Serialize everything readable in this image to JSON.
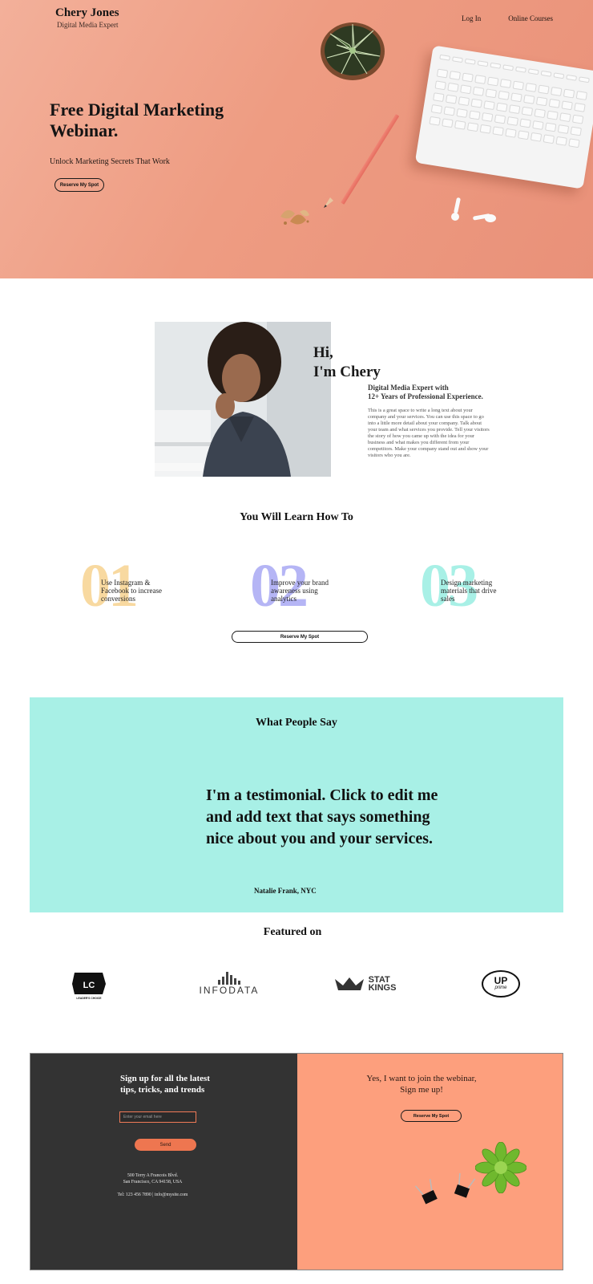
{
  "header": {
    "brand_name": "Chery Jones",
    "brand_tagline": "Digital Media Expert",
    "nav": [
      "Log In",
      "Online Courses"
    ]
  },
  "hero": {
    "title": "Free Digital Marketing Webinar.",
    "subtitle": "Unlock Marketing Secrets That Work",
    "cta": "Reserve My Spot"
  },
  "about": {
    "greeting_line1": "Hi,",
    "greeting_line2": "I'm Chery",
    "headline_line1": "Digital Media Expert with",
    "headline_line2": "12+ Years of Professional Experience.",
    "body": "This is a great space to write a long text about your company and your services. You can use this space to go into a little more detail about your company. Talk about your team and what services you provide. Tell your visitors the story of how you came up with the idea for your business and what makes you different from your competitors. Make your company stand out and show your visitors who you are."
  },
  "learn": {
    "title": "You Will Learn How To",
    "steps": [
      {
        "number": "01",
        "text": "Use Instagram & Facebook to increase conversions",
        "color": "#f8d9a0"
      },
      {
        "number": "02",
        "text": "Improve your brand awareness using analytics",
        "color": "#b5b5f5"
      },
      {
        "number": "03",
        "text": "Design marketing materials that drive sales",
        "color": "#a8f0e6"
      }
    ],
    "cta": "Reserve My Spot"
  },
  "testimonial": {
    "title": "What People Say",
    "quote": "I'm a testimonial. Click to edit me and add text that says something nice about you and your services.",
    "author": "Natalie Frank, NYC",
    "background": "#a8f0e6"
  },
  "featured": {
    "title": "Featured on",
    "logos": [
      {
        "name": "leaders-choice",
        "mark": "LC",
        "caption": "LEADER'S CHOICE"
      },
      {
        "name": "infodata",
        "text": "INFODATA"
      },
      {
        "name": "stat-kings",
        "line1": "STAT",
        "line2": "KINGS"
      },
      {
        "name": "up-prime",
        "line1": "UP",
        "line2": "prime"
      }
    ]
  },
  "signup": {
    "title_line1": "Sign up for all the latest",
    "title_line2": "tips, tricks, and trends",
    "email_placeholder": "Enter your email here",
    "send": "Send",
    "address_line1": "500 Terry A Francois Blvd.",
    "address_line2": "San Francisco, CA 94158, USA",
    "contact": "Tel: 123 456 7890 | info@mysite.com"
  },
  "join": {
    "title_line1": "Yes, I want to join the webinar,",
    "title_line2": "Sign me up!",
    "cta": "Reserve My Spot"
  },
  "colors": {
    "hero_peach": "#ee9c82",
    "footer_dark": "#333333",
    "footer_peach": "#fd9f7d",
    "accent_orange": "#ee7650"
  }
}
